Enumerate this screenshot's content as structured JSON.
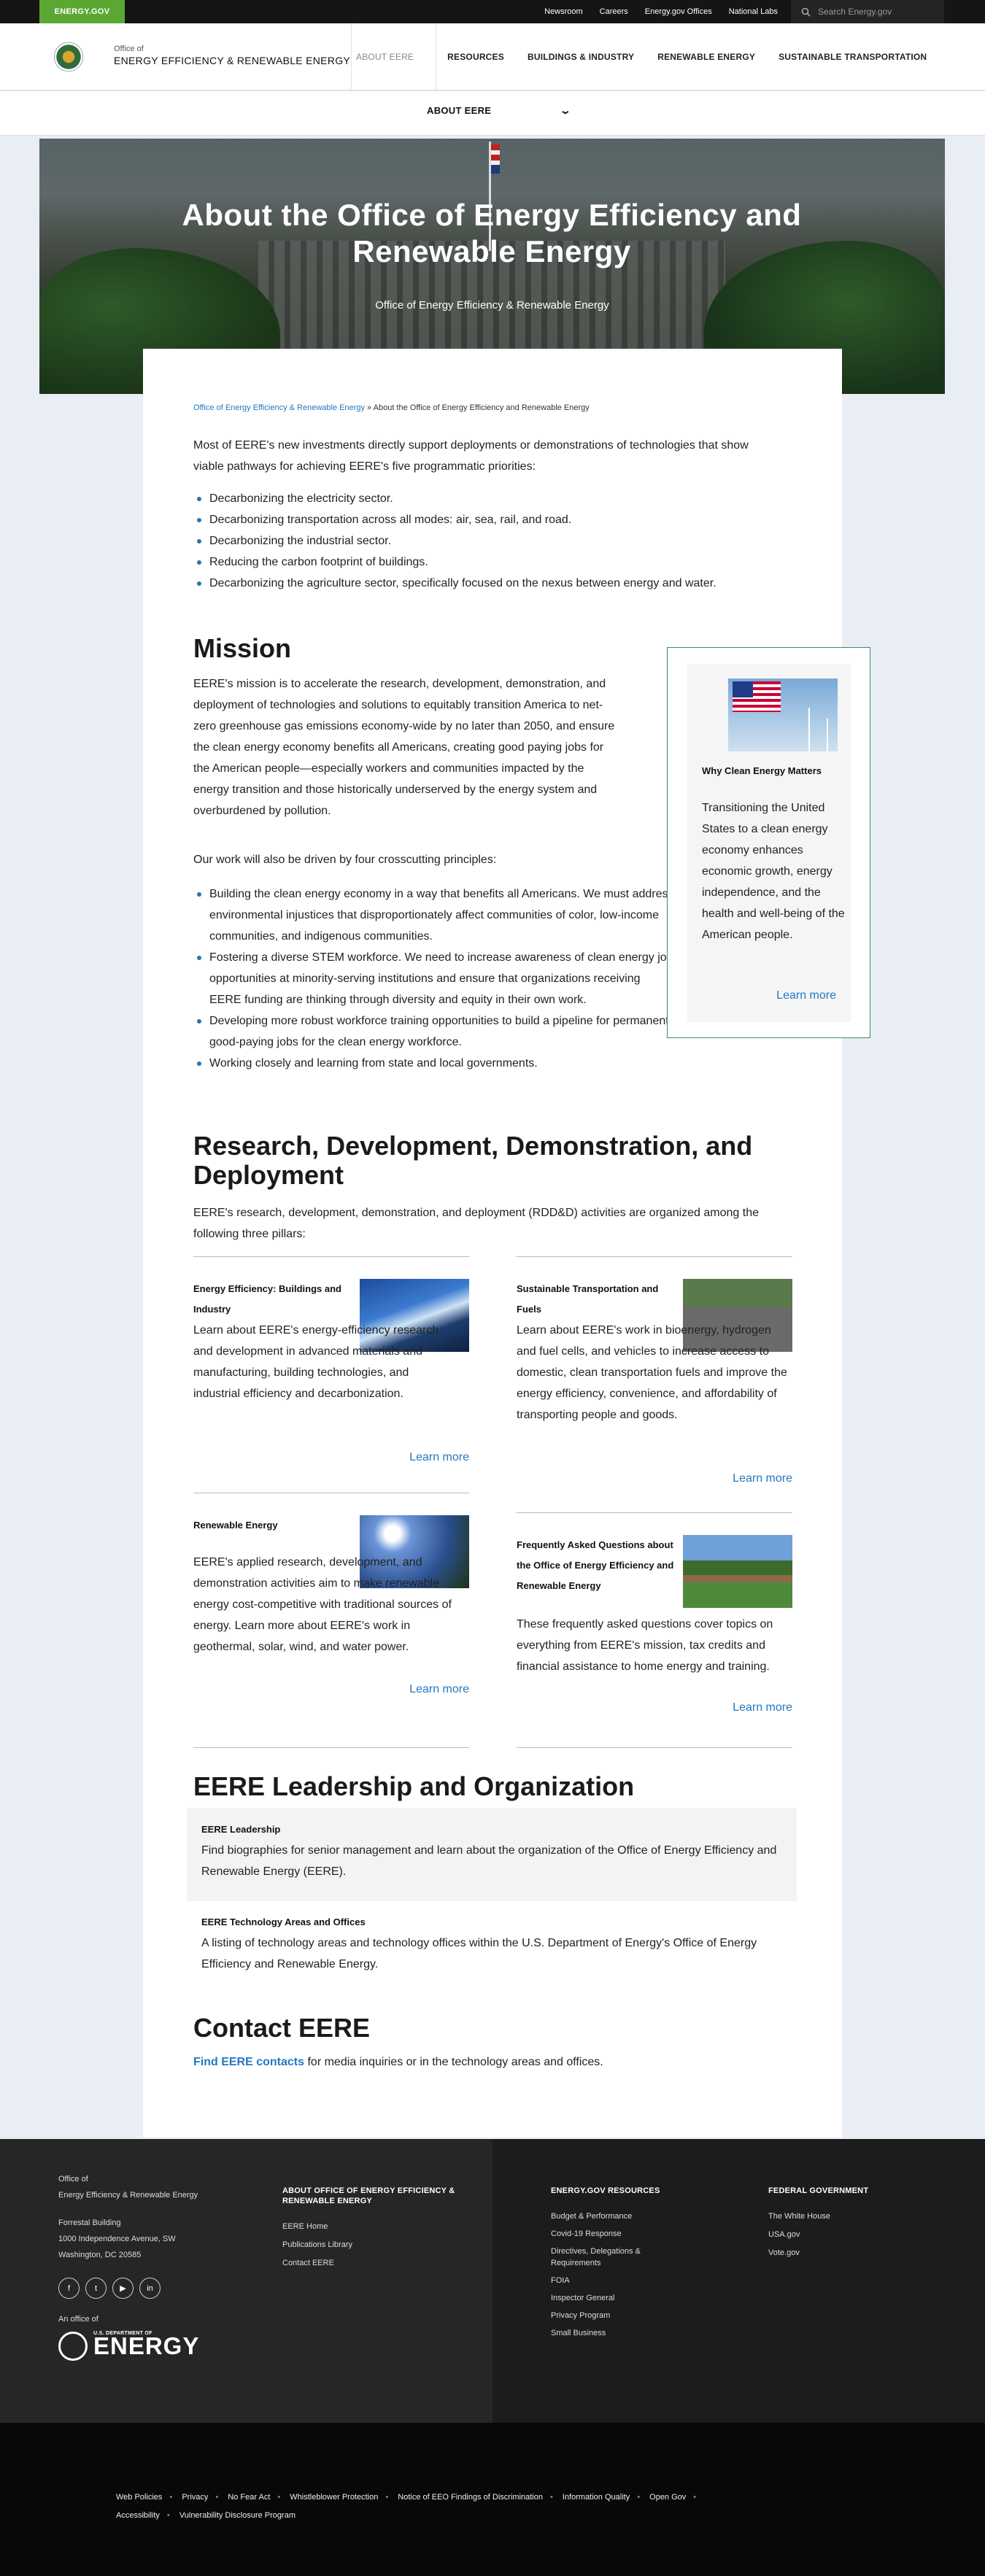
{
  "topbar": {
    "logo": "ENERGY.GOV",
    "links": [
      "Newsroom",
      "Careers",
      "Energy.gov Offices",
      "National Labs"
    ],
    "search_placeholder": "Search Energy.gov"
  },
  "header": {
    "site_sub": "Office of",
    "site_name": "ENERGY EFFICIENCY & RENEWABLE ENERGY",
    "nav": [
      "ABOUT EERE",
      "RESOURCES",
      "BUILDINGS & INDUSTRY",
      "RENEWABLE ENERGY",
      "SUSTAINABLE TRANSPORTATION"
    ]
  },
  "subnav": {
    "label": "ABOUT EERE"
  },
  "hero": {
    "title": "About the Office of Energy Efficiency and Renewable Energy",
    "subtitle": "Office of Energy Efficiency & Renewable Energy"
  },
  "breadcrumb": {
    "link": "Office of Energy Efficiency & Renewable Energy",
    "current": " » About the Office of Energy Efficiency and Renewable Energy"
  },
  "intro": "Most of EERE's new investments directly support deployments or demonstrations of technologies that show viable pathways for achieving EERE's five programmatic priorities:",
  "priorities": [
    "Decarbonizing the electricity sector.",
    "Decarbonizing transportation across all modes: air, sea, rail, and road.",
    "Decarbonizing the industrial sector.",
    "Reducing the carbon footprint of buildings.",
    "Decarbonizing the agriculture sector, specifically focused on the nexus between energy and water."
  ],
  "mission": {
    "heading": "Mission",
    "text": "EERE's mission is to accelerate the research, development, demonstration, and deployment of technologies and solutions to equitably transition America to net-zero greenhouse gas emissions economy-wide by no later than 2050, and ensure the clean energy economy benefits all Americans, creating good paying jobs for the American people—especially workers and communities impacted by the energy transition and those historically underserved by the energy system and overburdened by pollution.",
    "principles_intro": "Our work will also be driven by four crosscutting principles:",
    "principles": [
      "Building the clean energy economy in a way that benefits all Americans. We must address environmental injustices that disproportionately affect communities of color, low-income communities, and indigenous communities.",
      "Fostering a diverse STEM workforce. We need to increase awareness of clean energy job opportunities at minority-serving institutions and ensure that organizations receiving EERE funding are thinking through diversity and equity in their own work.",
      "Developing more robust workforce training opportunities to build a pipeline for permanent, good-paying jobs for the clean energy workforce.",
      "Working closely and learning from state and local governments."
    ]
  },
  "sidebar": {
    "title": "Why Clean Energy Matters",
    "text": "Transitioning the United States to a clean energy economy enhances economic growth, energy independence, and the health and well-being of the American people.",
    "link": "Learn more"
  },
  "rdd": {
    "heading": "Research, Development, Demonstration, and Deployment",
    "intro": "EERE's research, development, demonstration, and deployment (RDD&D) activities are organized among the following three pillars:",
    "pillars": [
      {
        "title": "Energy Efficiency: Buildings and Industry",
        "text": "Learn about EERE's energy-efficiency research and development in advanced materials and manufacturing, building technologies, and industrial efficiency and decarbonization.",
        "link": "Learn more"
      },
      {
        "title": "Sustainable Transportation and Fuels",
        "text": "Learn about EERE's work in bioenergy, hydrogen and fuel cells, and vehicles to increase access to domestic, clean transportation fuels and improve the energy efficiency, convenience, and affordability of transporting people and goods.",
        "link": "Learn more"
      },
      {
        "title": "Renewable Energy",
        "text": "EERE's applied research, development, and demonstration activities aim to make renewable energy cost-competitive with traditional sources of energy. Learn more about EERE's work in geothermal, solar, wind, and water power.",
        "link": "Learn more"
      },
      {
        "title": "Frequently Asked Questions about the Office of Energy Efficiency and Renewable Energy",
        "text": "These frequently asked questions cover topics on everything from EERE's mission, tax credits and financial assistance to home energy and training.",
        "link": "Learn more"
      }
    ]
  },
  "leadership": {
    "heading": "EERE Leadership and Organization",
    "items": [
      {
        "title": "EERE Leadership",
        "text": "Find biographies for senior management and learn about the organization of the Office of Energy Efficiency and Renewable Energy (EERE)."
      },
      {
        "title": "EERE Technology Areas and Offices",
        "text": "A listing of technology areas and technology offices within the U.S. Department of Energy's Office of Energy Efficiency and Renewable Energy."
      }
    ]
  },
  "contact": {
    "heading": "Contact EERE",
    "link": "Find EERE contacts",
    "text": " for media inquiries or in the technology areas and offices."
  },
  "footer": {
    "office_sub": "Office of",
    "office_name": "Energy Efficiency & Renewable Energy",
    "addr1": "Forrestal Building",
    "addr2": "1000 Independence Avenue, SW",
    "addr3": "Washington, DC 20585",
    "office_of": "An office of",
    "doe_small": "U.S. DEPARTMENT OF",
    "doe_big": "ENERGY",
    "about_heading": "ABOUT OFFICE OF ENERGY EFFICIENCY & RENEWABLE ENERGY",
    "about_links": [
      "EERE Home",
      "Publications Library",
      "Contact EERE"
    ],
    "resources_heading": "ENERGY.GOV RESOURCES",
    "resources_links": [
      "Budget & Performance",
      "Covid-19 Response",
      "Directives, Delegations & Requirements",
      "FOIA",
      "Inspector General",
      "Privacy Program",
      "Small Business"
    ],
    "federal_heading": "FEDERAL GOVERNMENT",
    "federal_links": [
      "The White House",
      "USA.gov",
      "Vote.gov"
    ],
    "bottom_links": [
      "Web Policies",
      "Privacy",
      "No Fear Act",
      "Whistleblower Protection",
      "Notice of EEO Findings of Discrimination",
      "Information Quality",
      "Open Gov",
      "Accessibility",
      "Vulnerability Disclosure Program"
    ]
  },
  "colors": {
    "green": "#5aa832",
    "link": "#2378c3",
    "teal_border": "#3a8a7a"
  }
}
